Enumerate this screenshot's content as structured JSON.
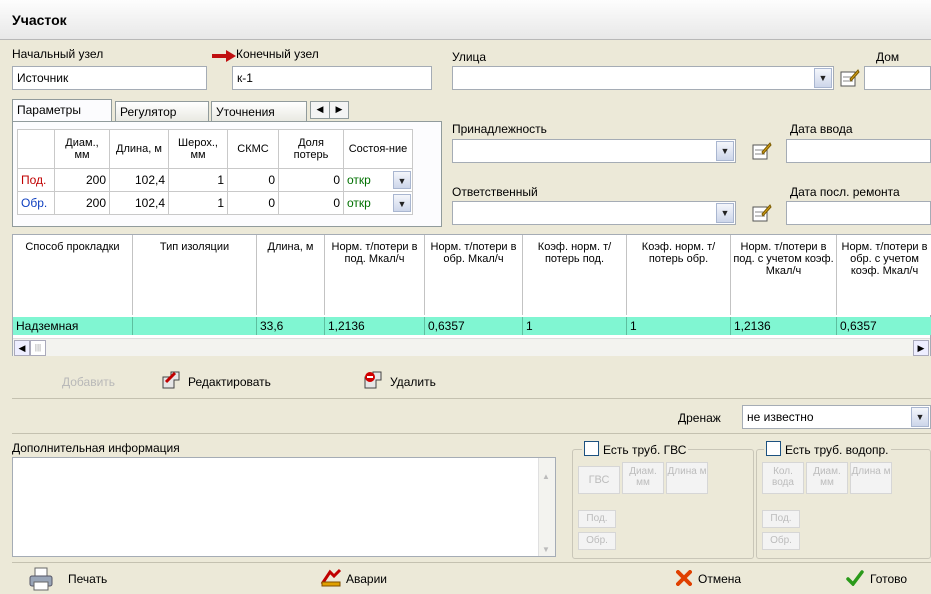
{
  "window": {
    "title": "Участок"
  },
  "nodes": {
    "start_label": "Начальный узел",
    "start_value": "Источник",
    "end_label": "Конечный узел",
    "end_value": "к-1"
  },
  "tabs": [
    "Параметры",
    "Регулятор",
    "Уточнения"
  ],
  "params": {
    "headers": [
      "",
      "Диам., мм",
      "Длина, м",
      "Шерох., мм",
      "СКМС",
      "Доля потерь",
      "Состоя-ние"
    ],
    "rows": [
      {
        "label": "Под.",
        "diam": "200",
        "length": "102,4",
        "rough": "1",
        "skms": "0",
        "loss": "0",
        "state": "откр"
      },
      {
        "label": "Обр.",
        "diam": "200",
        "length": "102,4",
        "rough": "1",
        "skms": "0",
        "loss": "0",
        "state": "откр"
      }
    ]
  },
  "right_fields": {
    "street_label": "Улица",
    "house_label": "Дом",
    "belong_label": "Принадлежность",
    "date_in_label": "Дата ввода",
    "resp_label": "Ответственный",
    "date_repair_label": "Дата посл. ремонта"
  },
  "grid": {
    "headers": [
      "Способ прокладки",
      "Тип изоляции",
      "Длина, м",
      "Норм. т/потери в под. Мкал/ч",
      "Норм. т/потери в обр. Мкал/ч",
      "Коэф. норм. т/потерь под.",
      "Коэф. норм. т/потерь обр.",
      "Норм. т/потери в под. с учетом коэф. Мкал/ч",
      "Норм. т/потери в обр. с учетом коэф. Мкал/ч"
    ],
    "row": [
      "Надземная",
      "",
      "33,6",
      "1,2136",
      "0,6357",
      "1",
      "1",
      "1,2136",
      "0,6357"
    ]
  },
  "actions": {
    "add": "Добавить",
    "edit": "Редактировать",
    "delete": "Удалить"
  },
  "drain": {
    "label": "Дренаж",
    "value": "не известно"
  },
  "extra_info_label": "Дополнительная информация",
  "gvs": {
    "label": "Есть труб. ГВС",
    "cols": [
      "ГВС",
      "Диам. мм",
      "Длина м"
    ],
    "rows": [
      "Под.",
      "Обр."
    ]
  },
  "water": {
    "label": "Есть труб. водопр.",
    "cols": [
      "Кол. вода",
      "Диам. мм",
      "Длина м"
    ],
    "rows": [
      "Под.",
      "Обр."
    ]
  },
  "footer": {
    "print": "Печать",
    "accidents": "Аварии",
    "cancel": "Отмена",
    "done": "Готово"
  }
}
